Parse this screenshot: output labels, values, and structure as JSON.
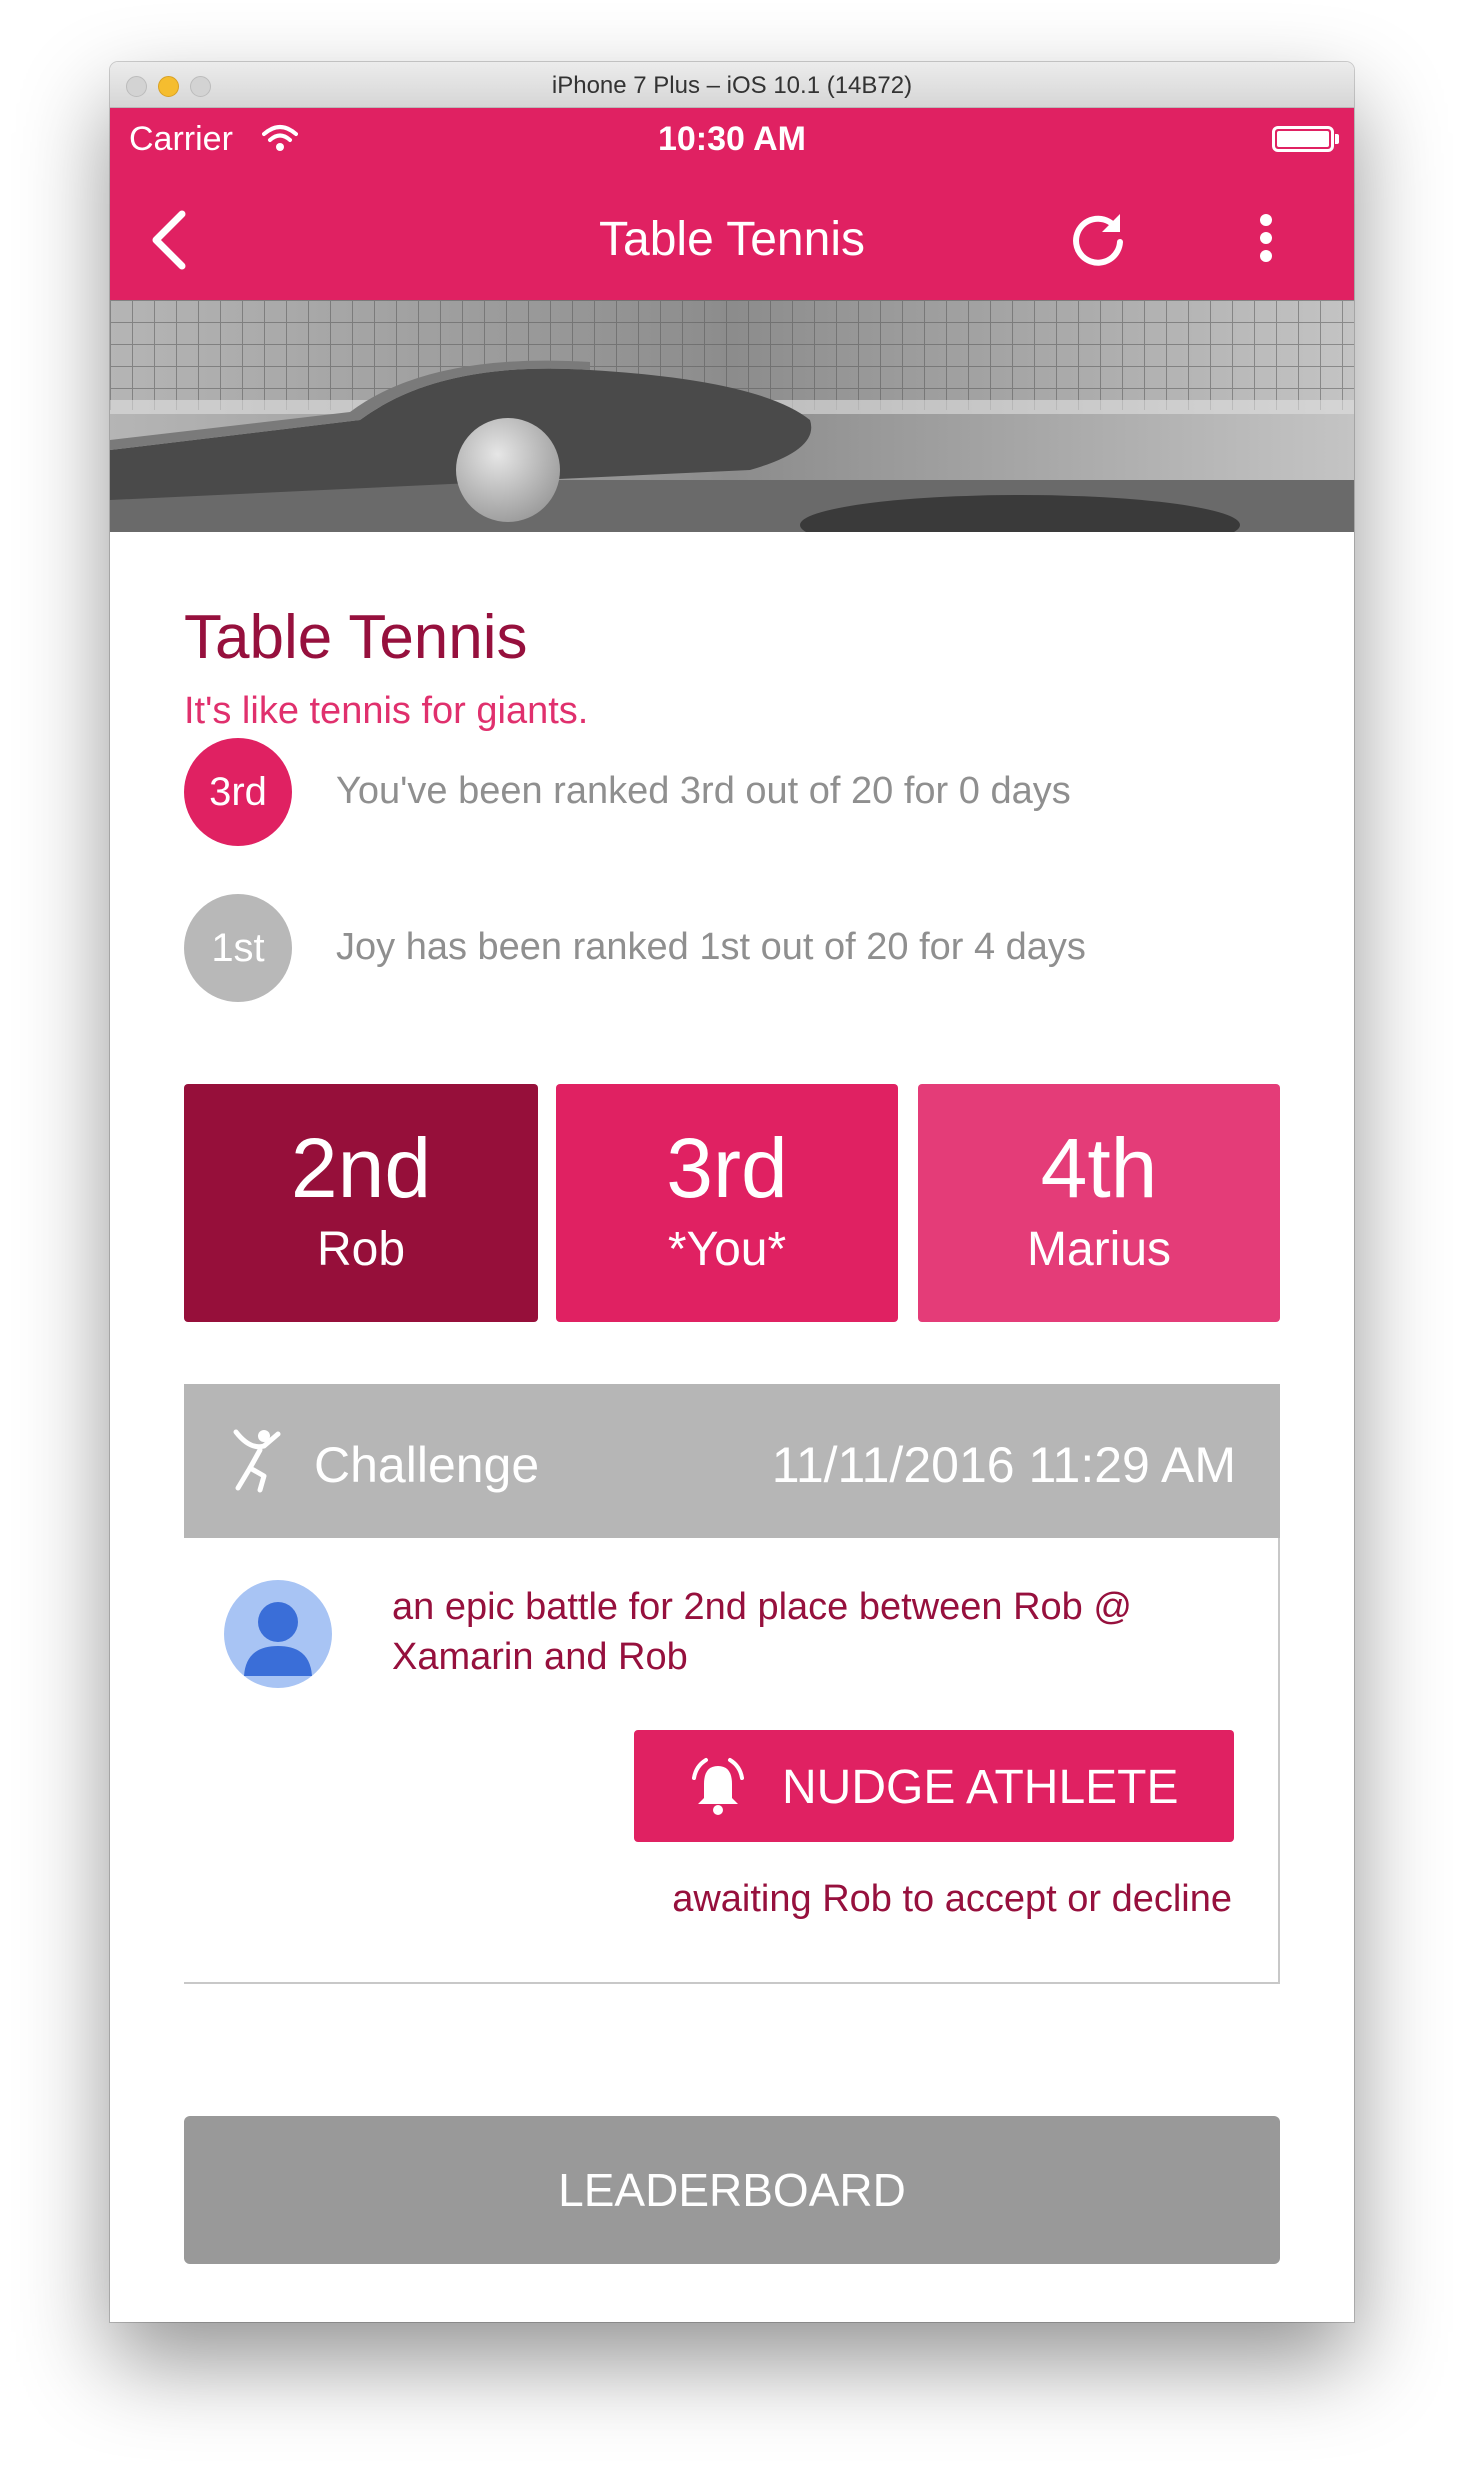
{
  "window": {
    "title": "iPhone 7 Plus – iOS 10.1 (14B72)"
  },
  "status_bar": {
    "carrier": "Carrier",
    "time": "10:30 AM"
  },
  "nav": {
    "title": "Table Tennis"
  },
  "league": {
    "name": "Table Tennis",
    "tagline": "It's like tennis for giants."
  },
  "rankings": [
    {
      "badge": "3rd",
      "text": "You've been ranked 3rd out of 20 for 0 days"
    },
    {
      "badge": "1st",
      "text": "Joy has been ranked 1st out of 20 for 4 days"
    }
  ],
  "tiles": [
    {
      "rank": "2nd",
      "name": "Rob",
      "color": "#960f3a"
    },
    {
      "rank": "3rd",
      "name": "*You*",
      "color": "#e02162"
    },
    {
      "rank": "4th",
      "name": "Marius",
      "color": "#e43c78"
    }
  ],
  "challenge": {
    "label": "Challenge",
    "date": "11/11/2016 11:29 AM",
    "description": "an epic battle for 2nd place between Rob @ Xamarin and Rob",
    "nudge_label": "NUDGE ATHLETE",
    "status": "awaiting Rob to accept or decline"
  },
  "leaderboard_label": "LEADERBOARD",
  "icons": {
    "back": "chevron-left-icon",
    "refresh": "refresh-icon",
    "more": "more-vertical-icon",
    "challenge": "athlete-icon",
    "nudge": "alarm-bell-icon",
    "avatar": "person-icon"
  },
  "colors": {
    "accent": "#e02162",
    "dark_accent": "#960f3a",
    "header_gray": "#b6b6b6",
    "button_gray": "#999999"
  }
}
